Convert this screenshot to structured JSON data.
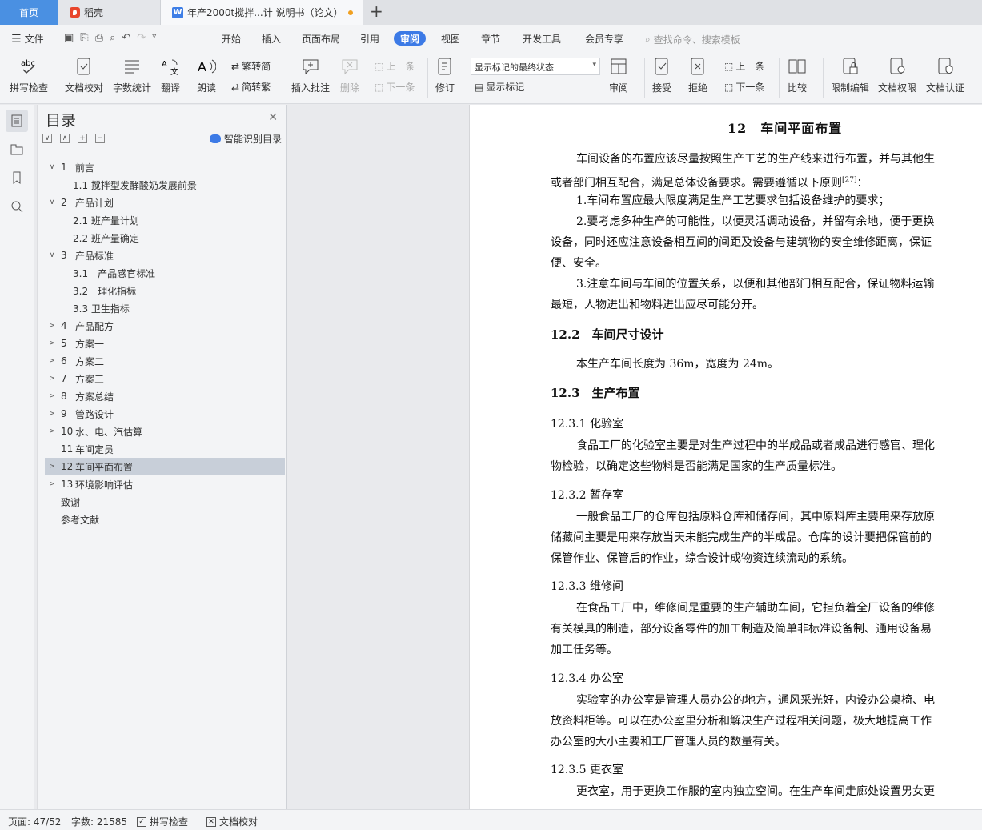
{
  "tabs": {
    "home": "首页",
    "daoke": "稻壳",
    "doc_icon": "W",
    "doc": "年产2000t搅拌...计 说明书（论文）",
    "new_tab": "+"
  },
  "menu": {
    "file": "文件",
    "items": [
      "开始",
      "插入",
      "页面布局",
      "引用",
      "审阅",
      "视图",
      "章节",
      "开发工具",
      "会员专享"
    ],
    "active": "审阅",
    "search_placeholder": "查找命令、搜索模板"
  },
  "ribbon": {
    "spellcheck": "拼写检查",
    "proofread": "文档校对",
    "wordcount": "字数统计",
    "translate": "翻译",
    "read_aloud": "朗读",
    "trad": "繁转简",
    "simp": "简转繁",
    "insert_comment": "插入批注",
    "delete": "删除",
    "prev": "上一条",
    "next": "下一条",
    "track": "修订",
    "markup_state": "显示标记的最终状态",
    "show_markup": "显示标记",
    "review": "审阅",
    "accept": "接受",
    "reject": "拒绝",
    "prev2": "上一条",
    "next2": "下一条",
    "compare": "比较",
    "restrict": "限制编辑",
    "permission": "文档权限",
    "certify": "文档认证"
  },
  "toc": {
    "title": "目录",
    "smart": "智能识别目录",
    "rows": [
      {
        "arrow": "∨",
        "num": "1",
        "text": "前言",
        "level": 1
      },
      {
        "text": "1.1 搅拌型发酵酸奶发展前景",
        "level": 2
      },
      {
        "arrow": "∨",
        "num": "2",
        "text": "产品计划",
        "level": 1
      },
      {
        "text": "2.1 班产量计划",
        "level": 2
      },
      {
        "text": "2.2 班产量确定",
        "level": 2
      },
      {
        "arrow": "∨",
        "num": "3",
        "text": "产品标准",
        "level": 1
      },
      {
        "text": "3.1　产品感官标准",
        "level": 2
      },
      {
        "text": "3.2　理化指标",
        "level": 2
      },
      {
        "text": "3.3 卫生指标",
        "level": 2
      },
      {
        "arrow": ">",
        "num": "4",
        "text": "产品配方",
        "level": 1
      },
      {
        "arrow": ">",
        "num": "5",
        "text": "方案一",
        "level": 1
      },
      {
        "arrow": ">",
        "num": "6",
        "text": "方案二",
        "level": 1
      },
      {
        "arrow": ">",
        "num": "7",
        "text": "方案三",
        "level": 1
      },
      {
        "arrow": ">",
        "num": "8",
        "text": "方案总结",
        "level": 1
      },
      {
        "arrow": ">",
        "num": "9",
        "text": "管路设计",
        "level": 1
      },
      {
        "arrow": ">",
        "num": "10",
        "text": "水、电、汽估算",
        "level": 1
      },
      {
        "num": "11",
        "text": "车间定员",
        "level": 1
      },
      {
        "arrow": ">",
        "num": "12",
        "text": "车间平面布置",
        "level": 1,
        "active": true
      },
      {
        "arrow": ">",
        "num": "13",
        "text": "环境影响评估",
        "level": 1
      },
      {
        "text": "致谢",
        "level": 0
      },
      {
        "text": "参考文献",
        "level": 0
      }
    ]
  },
  "document": {
    "h1": "12　车间平面布置",
    "intro_1": "车间设备的布置应该尽量按照生产工艺的生产线来进行布置，并与其他生",
    "intro_2": "或者部门相互配合，满足总体设备要求。需要遵循以下原则[27]：",
    "rule1": "1.车间布置应最大限度满足生产工艺要求包括设备维护的要求；",
    "rule2_1": "2.要考虑多种生产的可能性，以便灵活调动设备，并留有余地，便于更换",
    "rule2_2": "设备，同时还应注意设备相互间的间距及设备与建筑物的安全维修距离，保证",
    "rule2_3": "便、安全。",
    "rule3_1": "3.注意车间与车间的位置关系，以便和其他部门相互配合，保证物料运输",
    "rule3_2": "最短，人物进出和物料进出应尽可能分开。",
    "h2_1": "12.2　车间尺寸设计",
    "size": "本生产车间长度为 36m，宽度为 24m。",
    "h2_2": "12.3　生产布置",
    "h3_1": "12.3.1  化验室",
    "lab_1": "食品工厂的化验室主要是对生产过程中的半成品或者成品进行感官、理化",
    "lab_2": "物检验，以确定这些物料是否能满足国家的生产质量标准。",
    "h3_2": "12.3.2  暂存室",
    "store_1": "一般食品工厂的仓库包括原料仓库和储存间，其中原料库主要用来存放原",
    "store_2": "储藏间主要是用来存放当天未能完成生产的半成品。仓库的设计要把保管前的",
    "store_3": "保管作业、保管后的作业，综合设计成物资连续流动的系统。",
    "h3_3": "12.3.3  维修间",
    "repair_1": "在食品工厂中，维修间是重要的生产辅助车间，它担负着全厂设备的维修",
    "repair_2": "有关模具的制造，部分设备零件的加工制造及简单非标准设备制、通用设备易",
    "repair_3": "加工任务等。",
    "h3_4": "12.3.4  办公室",
    "office_1": "实验室的办公室是管理人员办公的地方，通风采光好，内设办公桌椅、电",
    "office_2": "放资料柜等。可以在办公室里分析和解决生产过程相关问题，极大地提高工作",
    "office_3": "办公室的大小主要和工厂管理人员的数量有关。",
    "h3_5": "12.3.5  更衣室",
    "locker_1": "更衣室，用于更换工作服的室内独立空间。在生产车间走廊处设置男女更"
  },
  "status": {
    "page": "页面: 47/52",
    "words": "字数: 21585",
    "spell": "拼写检查",
    "proof": "文档校对"
  }
}
